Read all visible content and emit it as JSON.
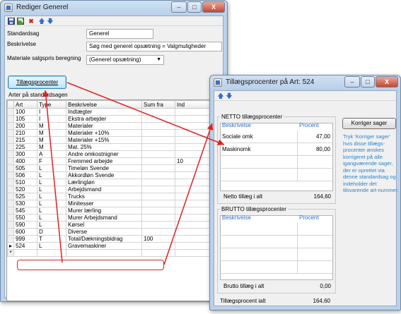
{
  "main_window": {
    "title": "Rediger Generel",
    "controls": {
      "minimize": "–",
      "maximize": "□",
      "close": "X"
    },
    "toolbar_icons": [
      "save-icon",
      "save-new-icon",
      "delete-icon",
      "arrow-up-icon",
      "arrow-down-icon"
    ],
    "form": {
      "standardsag_label": "Standardsag",
      "standardsag_value": "Generel",
      "beskrivelse_label": "Beskrivelse",
      "beskrivelse_value": "Søg med generel opsætning = Valgmuligheder",
      "materiale_label": "Materiale salgspris beregning",
      "materiale_value": "(Generel opsætning)"
    },
    "tillaeg_button": "Tillægsprocenter",
    "grid_caption": "Arter på standardsagen",
    "columns": [
      "Art",
      "Type",
      "Beskrivelse",
      "Sum fra",
      "Ind"
    ],
    "rows": [
      [
        "100",
        "I",
        "Indtægter",
        "",
        ""
      ],
      [
        "105",
        "I",
        "Ekstra arbejder",
        "",
        ""
      ],
      [
        "200",
        "M",
        "Materialer",
        "",
        ""
      ],
      [
        "210",
        "M",
        "Materialer +10%",
        "",
        ""
      ],
      [
        "215",
        "M",
        "Materialer +15%",
        "",
        ""
      ],
      [
        "225",
        "M",
        "Mat. 25%",
        "",
        ""
      ],
      [
        "300",
        "A",
        "Andre omkostnigner",
        "",
        ""
      ],
      [
        "400",
        "F",
        "Fremmed arbejde",
        "",
        "10"
      ],
      [
        "505",
        "L",
        "Timeløn Svende",
        "",
        ""
      ],
      [
        "506",
        "L",
        "Akkordløn Svende",
        "",
        ""
      ],
      [
        "510",
        "L",
        "Lærlingløn",
        "",
        ""
      ],
      [
        "520",
        "L",
        "Arbejdsmand",
        "",
        ""
      ],
      [
        "525",
        "L",
        "Trucks",
        "",
        ""
      ],
      [
        "530",
        "L",
        "Minitesser",
        "",
        ""
      ],
      [
        "545",
        "L",
        "Murer lærling",
        "",
        ""
      ],
      [
        "550",
        "L",
        "Murer Arbejdsmand",
        "",
        ""
      ],
      [
        "590",
        "L",
        "Kørsel",
        "",
        ""
      ],
      [
        "600",
        "D",
        "Diverse",
        "",
        ""
      ],
      [
        "999",
        "T",
        "Total/Dækningsbidrag",
        "100",
        ""
      ],
      [
        "524",
        "L",
        "Gravemaskiner",
        "",
        ""
      ]
    ],
    "new_row_marker": "*"
  },
  "sub_window": {
    "title": "Tillægsprocenter på Art: 524",
    "controls": {
      "minimize": "–",
      "maximize": "□",
      "close": "X"
    },
    "toolbar_icons": [
      "arrow-up-icon",
      "arrow-down-icon"
    ],
    "netto": {
      "caption": "NETTO tillægsprocenter",
      "col_beskrivelse": "Beskrivelse",
      "col_procent": "Procent",
      "rows": [
        {
          "beskrivelse": "Sociale omk",
          "procent": "47,00"
        },
        {
          "beskrivelse": "Maskinomk",
          "procent": "80,00"
        },
        {
          "beskrivelse": "",
          "procent": ""
        },
        {
          "beskrivelse": "",
          "procent": ""
        }
      ],
      "total_label": "Netto tillæg i alt",
      "total_value": "164,60"
    },
    "brutto": {
      "caption": "BRUTTO tillægsprocenter",
      "col_beskrivelse": "Beskrivelse",
      "col_procent": "Procent",
      "rows": [
        {
          "beskrivelse": "",
          "procent": ""
        },
        {
          "beskrivelse": "",
          "procent": ""
        },
        {
          "beskrivelse": "",
          "procent": ""
        },
        {
          "beskrivelse": "",
          "procent": ""
        }
      ],
      "total_label": "Brutto tillæg i alt",
      "total_value": "0,00"
    },
    "korriger_button": "Korriger sager",
    "note": "Tryk 'Korriger sager' hvis disse tillægs-procenter ønskes korrigeret på alle igangværende sager, der er oprettet via denne standardsag og indeholder det tilsvarende art-nummer.",
    "grand_total_label": "Tillægsprocent  ialt",
    "grand_total_value": "164,60"
  },
  "colors": {
    "highlight": "#e02020",
    "note_text": "#2d84c8",
    "header_text": "#2b6cc4"
  }
}
